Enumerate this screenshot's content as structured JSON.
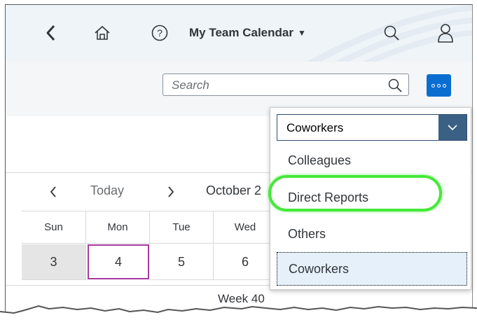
{
  "shell": {
    "title": "My Team Calendar",
    "icons": [
      "back-icon",
      "home-icon",
      "help-icon",
      "search-icon",
      "user-icon"
    ]
  },
  "search": {
    "placeholder": "Search"
  },
  "calendar": {
    "nav_today": "Today",
    "month_label": "October 2",
    "weekdays": [
      "Sun",
      "Mon",
      "Tue",
      "Wed"
    ],
    "dates": [
      "3",
      "4",
      "5",
      "6"
    ],
    "selected_date": "4",
    "week_label": "Week 40"
  },
  "dropdown": {
    "selected_value": "Coworkers",
    "options": [
      "Colleagues",
      "Direct Reports",
      "Others",
      "Coworkers"
    ],
    "highlighted_option": "Direct Reports"
  },
  "colors": {
    "accent": "#0a6ed1",
    "select_arrow_bg": "#3a6184",
    "today_border": "#a53aa0",
    "annotation": "#46e83a"
  }
}
